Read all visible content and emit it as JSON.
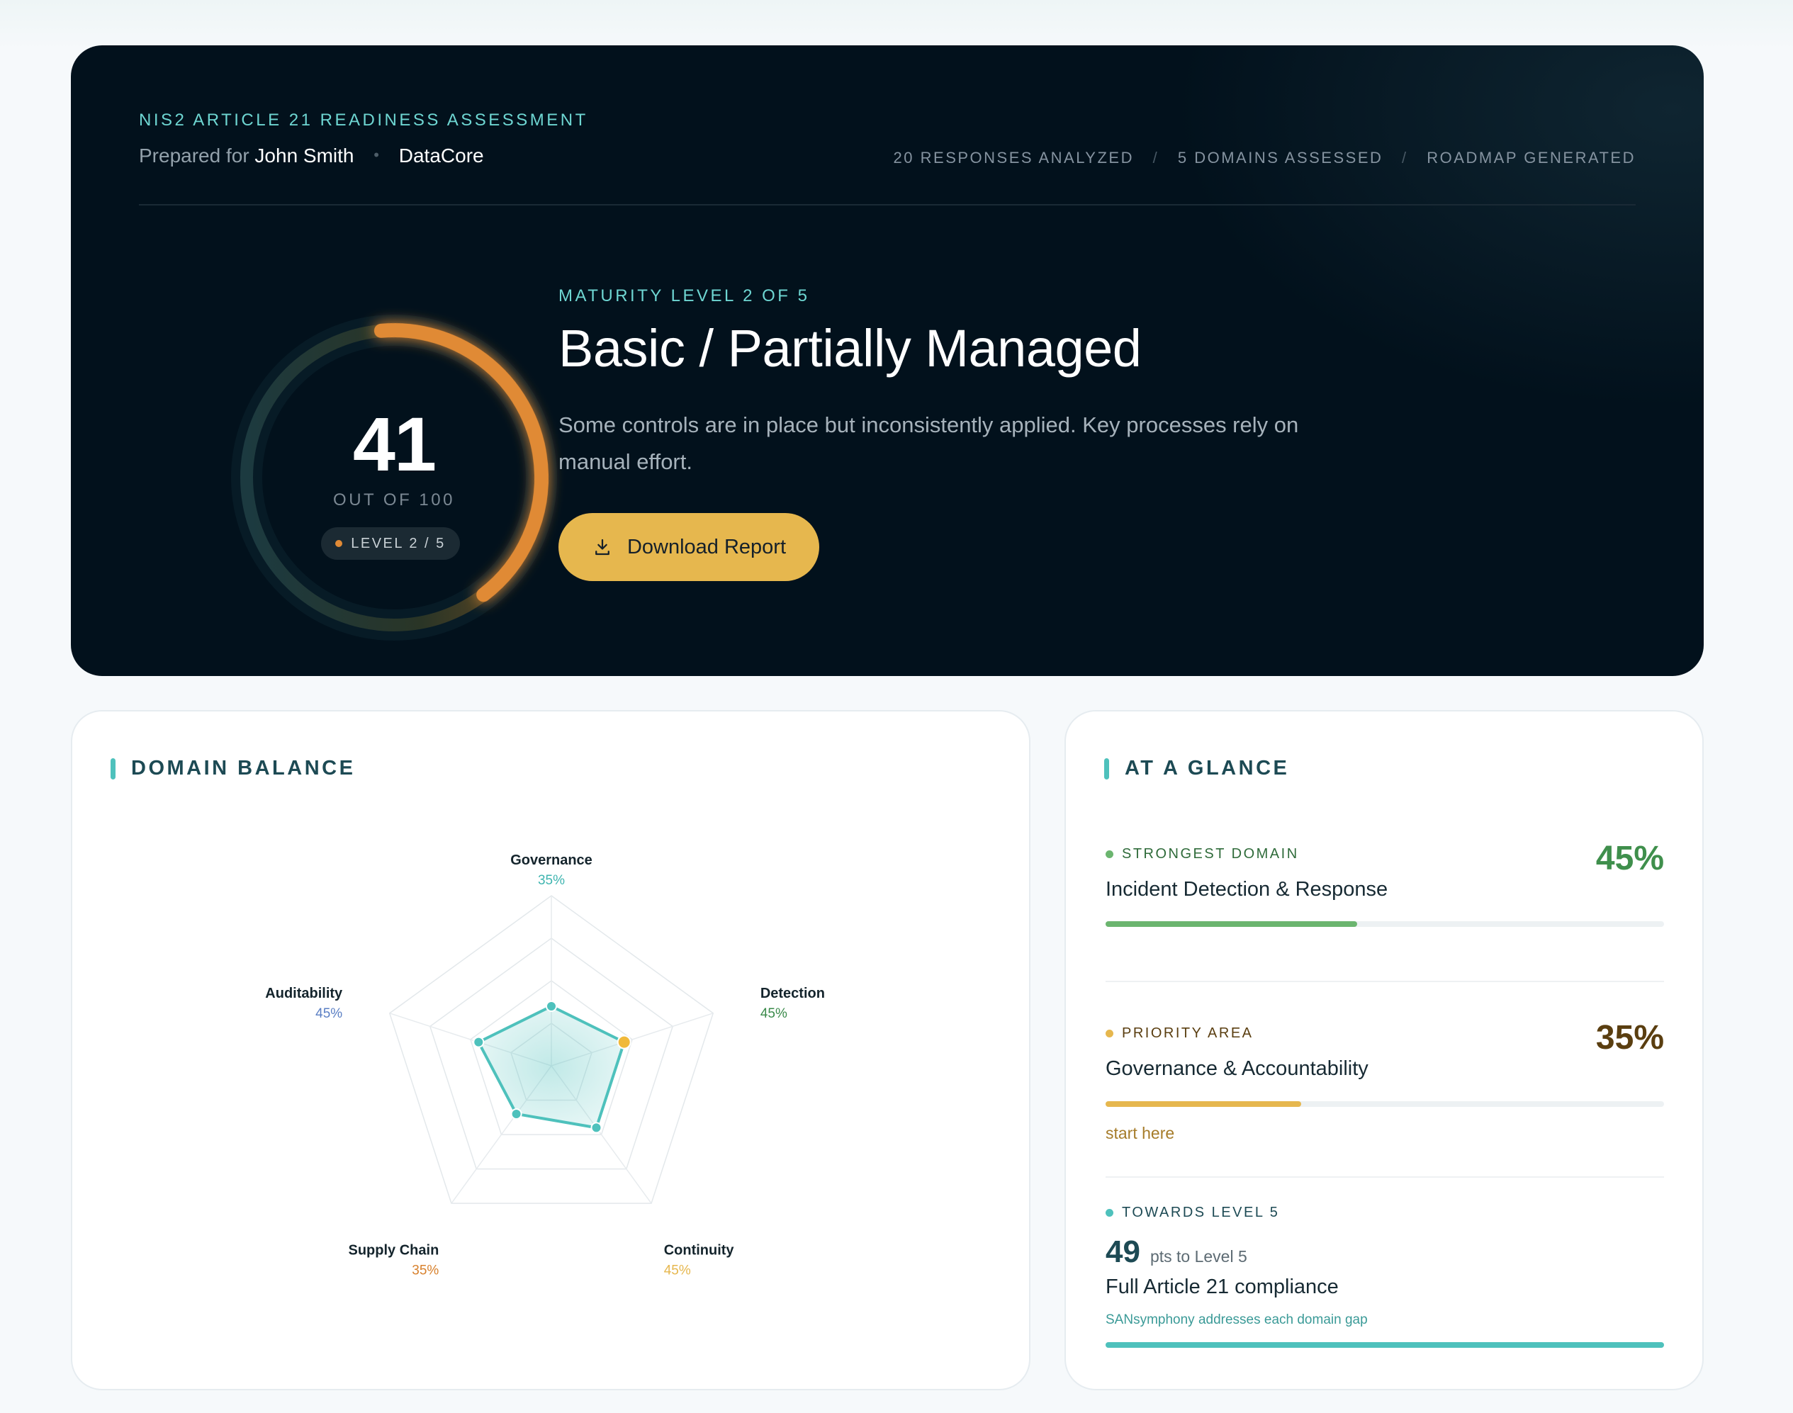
{
  "hero": {
    "eyebrow": "NIS2 ARTICLE 21 READINESS ASSESSMENT",
    "prepared_prefix": "Prepared for",
    "person": "John Smith",
    "dot": "•",
    "company": "DataCore",
    "stats": [
      "20 RESPONSES ANALYZED",
      "5 DOMAINS ASSESSED",
      "ROADMAP GENERATED"
    ],
    "stat_sep": "/",
    "score": "41",
    "score_max_label": "OUT OF 100",
    "score_fraction": 0.41,
    "level_pill": "LEVEL 2 / 5",
    "maturity_eyebrow": "MATURITY LEVEL 2 OF 5",
    "maturity_title": "Basic / Partially Managed",
    "maturity_desc": "Some controls are in place but inconsistently applied. Key processes rely on manual effort.",
    "download_label": "Download Report",
    "colors": {
      "accent": "#6ed6d2",
      "orange": "#e08a36",
      "button": "#e6b74e",
      "bg": "#02111c"
    }
  },
  "domain_balance": {
    "title": "DOMAIN BALANCE"
  },
  "chart_data": {
    "type": "radar",
    "axes": [
      "Governance",
      "Detection",
      "Continuity",
      "Supply Chain",
      "Auditability"
    ],
    "value_labels": [
      "35%",
      "45%",
      "45%",
      "35%",
      "45%"
    ],
    "values": [
      35,
      45,
      45,
      35,
      45
    ],
    "range": [
      0,
      100
    ],
    "rings": 4,
    "label_colors": [
      "#3fb5b0",
      "#3a8a4a",
      "#e6b74e",
      "#d8812d",
      "#5b7fc4"
    ],
    "series_color": "#4ec1bc",
    "highlight_point": "Detection",
    "highlight_color": "#f0b93a"
  },
  "glance": {
    "title": "AT A GLANCE",
    "strongest": {
      "label": "STRONGEST DOMAIN",
      "name": "Incident Detection & Response",
      "pct_label": "45%",
      "fraction": 0.45,
      "color": "#3f8f4c",
      "bar_color": "#6bb56f"
    },
    "priority": {
      "label": "PRIORITY AREA",
      "name": "Governance & Accountability",
      "pct_label": "35%",
      "fraction": 0.35,
      "color": "#5a3e10",
      "bar_color": "#e6b74e",
      "note": "start here"
    },
    "towards": {
      "label": "TOWARDS LEVEL 5",
      "points": "49",
      "points_suffix": "pts to Level 5",
      "name": "Full Article 21 compliance",
      "sub": "SANsymphony addresses each domain gap",
      "fraction": 1.0,
      "bar_color": "#4ec1bc"
    }
  }
}
